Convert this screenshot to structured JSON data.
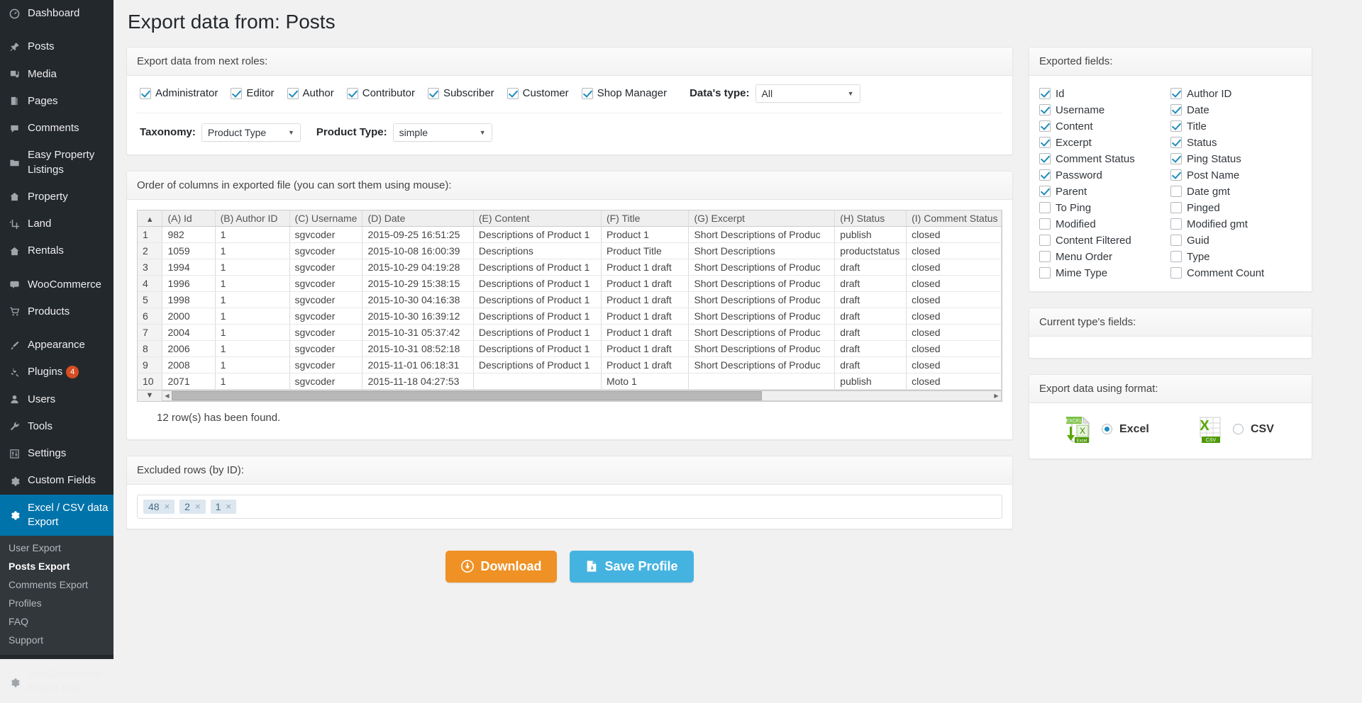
{
  "sidebar": {
    "items": [
      {
        "label": "Dashboard",
        "icon": "dashboard-icon",
        "group": 0
      },
      {
        "label": "Posts",
        "icon": "pin-icon",
        "group": 1
      },
      {
        "label": "Media",
        "icon": "media-icon",
        "group": 1
      },
      {
        "label": "Pages",
        "icon": "pages-icon",
        "group": 1
      },
      {
        "label": "Comments",
        "icon": "comments-icon",
        "group": 1
      },
      {
        "label": "Easy Property Listings",
        "icon": "folder-icon",
        "group": 1
      },
      {
        "label": "Property",
        "icon": "home-icon",
        "group": 1
      },
      {
        "label": "Land",
        "icon": "crop-icon",
        "group": 1
      },
      {
        "label": "Rentals",
        "icon": "home-icon",
        "group": 1
      },
      {
        "label": "WooCommerce",
        "icon": "woo-icon",
        "group": 2
      },
      {
        "label": "Products",
        "icon": "cart-icon",
        "group": 2
      },
      {
        "label": "Appearance",
        "icon": "brush-icon",
        "group": 3
      },
      {
        "label": "Plugins",
        "icon": "plug-icon",
        "group": 3,
        "badge": "4"
      },
      {
        "label": "Users",
        "icon": "user-icon",
        "group": 3
      },
      {
        "label": "Tools",
        "icon": "wrench-icon",
        "group": 3
      },
      {
        "label": "Settings",
        "icon": "sliders-icon",
        "group": 3
      },
      {
        "label": "Custom Fields",
        "icon": "gear-icon",
        "group": 3
      }
    ],
    "active": {
      "label": "Excel / CSV data Export",
      "icon": "gear-icon"
    },
    "submenu": [
      {
        "label": "User Export",
        "current": false
      },
      {
        "label": "Posts Export",
        "current": true
      },
      {
        "label": "Comments Export",
        "current": false
      },
      {
        "label": "Profiles",
        "current": false
      },
      {
        "label": "FAQ",
        "current": false
      },
      {
        "label": "Support",
        "current": false
      }
    ],
    "footer_item": {
      "label": "WooCommerce Export Data",
      "icon": "gear-icon"
    }
  },
  "page": {
    "title": "Export data from: Posts"
  },
  "roles_panel": {
    "header": "Export data from next roles:",
    "roles": [
      {
        "label": "Administrator",
        "checked": true
      },
      {
        "label": "Editor",
        "checked": true
      },
      {
        "label": "Author",
        "checked": true
      },
      {
        "label": "Contributor",
        "checked": true
      },
      {
        "label": "Subscriber",
        "checked": true
      },
      {
        "label": "Customer",
        "checked": true
      },
      {
        "label": "Shop Manager",
        "checked": true
      }
    ],
    "datas_type_label": "Data's type:",
    "datas_type_value": "All",
    "taxonomy_label": "Taxonomy:",
    "taxonomy_value": "Product Type",
    "product_type_label": "Product Type:",
    "product_type_value": "simple"
  },
  "table_panel": {
    "header": "Order of columns in exported file (you can sort them using mouse):",
    "sorted_column": "(A) Id",
    "columns": [
      "(A) Id",
      "(B) Author ID",
      "(C) Username",
      "(D) Date",
      "(E) Content",
      "(F) Title",
      "(G) Excerpt",
      "(H) Status",
      "(I) Comment Status"
    ],
    "rows": [
      {
        "n": "1",
        "id": "982",
        "author": "1",
        "user": "sgvcoder",
        "date": "2015-09-25 16:51:25",
        "content": "Descriptions of Product 1",
        "title": "Product 1",
        "excerpt": "Short Descriptions of Produc",
        "status": "publish",
        "cstatus": "closed"
      },
      {
        "n": "2",
        "id": "1059",
        "author": "1",
        "user": "sgvcoder",
        "date": "2015-10-08 16:00:39",
        "content": "Descriptions",
        "title": "Product Title",
        "excerpt": "Short Descriptions",
        "status": "productstatus",
        "cstatus": "closed"
      },
      {
        "n": "3",
        "id": "1994",
        "author": "1",
        "user": "sgvcoder",
        "date": "2015-10-29 04:19:28",
        "content": "Descriptions of Product 1",
        "title": "Product 1 draft",
        "excerpt": "Short Descriptions of Produc",
        "status": "draft",
        "cstatus": "closed"
      },
      {
        "n": "4",
        "id": "1996",
        "author": "1",
        "user": "sgvcoder",
        "date": "2015-10-29 15:38:15",
        "content": "Descriptions of Product 1",
        "title": "Product 1 draft",
        "excerpt": "Short Descriptions of Produc",
        "status": "draft",
        "cstatus": "closed"
      },
      {
        "n": "5",
        "id": "1998",
        "author": "1",
        "user": "sgvcoder",
        "date": "2015-10-30 04:16:38",
        "content": "Descriptions of Product 1",
        "title": "Product 1 draft",
        "excerpt": "Short Descriptions of Produc",
        "status": "draft",
        "cstatus": "closed"
      },
      {
        "n": "6",
        "id": "2000",
        "author": "1",
        "user": "sgvcoder",
        "date": "2015-10-30 16:39:12",
        "content": "Descriptions of Product 1",
        "title": "Product 1 draft",
        "excerpt": "Short Descriptions of Produc",
        "status": "draft",
        "cstatus": "closed"
      },
      {
        "n": "7",
        "id": "2004",
        "author": "1",
        "user": "sgvcoder",
        "date": "2015-10-31 05:37:42",
        "content": "Descriptions of Product 1",
        "title": "Product 1 draft",
        "excerpt": "Short Descriptions of Produc",
        "status": "draft",
        "cstatus": "closed"
      },
      {
        "n": "8",
        "id": "2006",
        "author": "1",
        "user": "sgvcoder",
        "date": "2015-10-31 08:52:18",
        "content": "Descriptions of Product 1",
        "title": "Product 1 draft",
        "excerpt": "Short Descriptions of Produc",
        "status": "draft",
        "cstatus": "closed"
      },
      {
        "n": "9",
        "id": "2008",
        "author": "1",
        "user": "sgvcoder",
        "date": "2015-11-01 06:18:31",
        "content": "Descriptions of Product 1",
        "title": "Product 1 draft",
        "excerpt": "Short Descriptions of Produc",
        "status": "draft",
        "cstatus": "closed"
      },
      {
        "n": "10",
        "id": "2071",
        "author": "1",
        "user": "sgvcoder",
        "date": "2015-11-18 04:27:53",
        "content": "",
        "title": "Moto 1",
        "excerpt": "",
        "status": "publish",
        "cstatus": "closed"
      }
    ],
    "found_text": "12 row(s) has been found.",
    "sort_asc_glyph": "▲",
    "sort_desc_glyph": "▼"
  },
  "excluded_panel": {
    "header": "Excluded rows (by ID):",
    "tags": [
      "48",
      "2",
      "1"
    ],
    "remove_glyph": "×"
  },
  "actions": {
    "download_label": "Download",
    "download_icon": "download-circle-icon",
    "save_label": "Save Profile",
    "save_icon": "save-file-icon"
  },
  "fields_panel": {
    "header": "Exported fields:",
    "left": [
      {
        "label": "Id",
        "checked": true
      },
      {
        "label": "Username",
        "checked": true
      },
      {
        "label": "Content",
        "checked": true
      },
      {
        "label": "Excerpt",
        "checked": true
      },
      {
        "label": "Comment Status",
        "checked": true
      },
      {
        "label": "Password",
        "checked": true
      },
      {
        "label": "Parent",
        "checked": true
      },
      {
        "label": "To Ping",
        "checked": false
      },
      {
        "label": "Modified",
        "checked": false
      },
      {
        "label": "Content Filtered",
        "checked": false
      },
      {
        "label": "Menu Order",
        "checked": false
      },
      {
        "label": "Mime Type",
        "checked": false
      }
    ],
    "right": [
      {
        "label": "Author ID",
        "checked": true
      },
      {
        "label": "Date",
        "checked": true
      },
      {
        "label": "Title",
        "checked": true
      },
      {
        "label": "Status",
        "checked": true
      },
      {
        "label": "Ping Status",
        "checked": true
      },
      {
        "label": "Post Name",
        "checked": true
      },
      {
        "label": "Date gmt",
        "checked": false
      },
      {
        "label": "Pinged",
        "checked": false
      },
      {
        "label": "Modified gmt",
        "checked": false
      },
      {
        "label": "Guid",
        "checked": false
      },
      {
        "label": "Type",
        "checked": false
      },
      {
        "label": "Comment Count",
        "checked": false
      }
    ]
  },
  "current_type_panel": {
    "header": "Current type's fields:"
  },
  "format_panel": {
    "header": "Export data using format:",
    "options": [
      {
        "label": "Excel",
        "selected": true,
        "icon": "excel-file-icon",
        "badge": "EXCEL",
        "sub": "Excel"
      },
      {
        "label": "CSV",
        "selected": false,
        "icon": "csv-file-icon",
        "badge": "CSV",
        "sub": "CSV"
      }
    ]
  },
  "colors": {
    "wp_sidebar": "#23282d",
    "wp_submenu": "#32373c",
    "accent_blue": "#0073aa",
    "sorted_header": "#6bb8f0",
    "download_orange": "#ef9125",
    "save_blue": "#45b3e0",
    "badge_red": "#d54e21",
    "excel_green": "#4e9a06"
  }
}
